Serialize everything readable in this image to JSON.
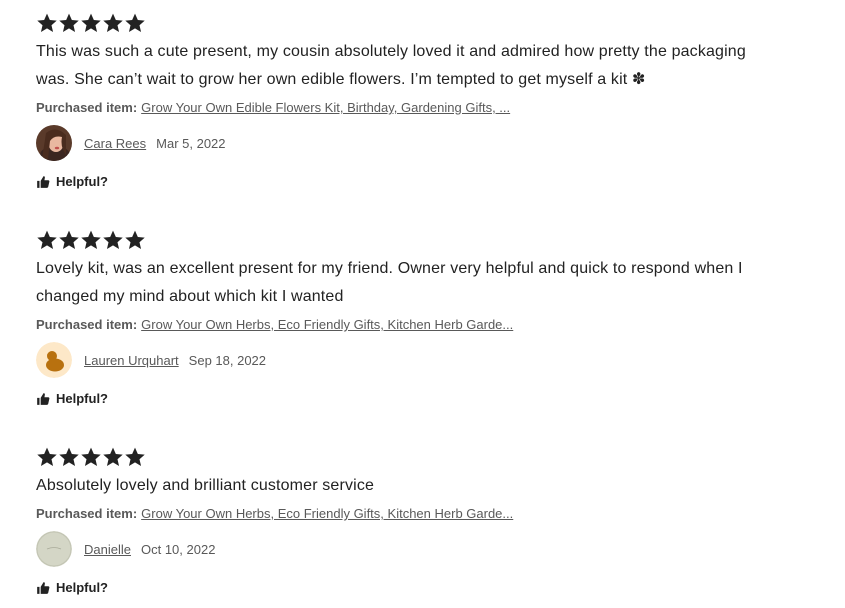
{
  "reviews": [
    {
      "rating": 5,
      "text_line1": "This was such a cute present, my cousin absolutely loved it and admired how pretty the packaging",
      "text_line2": "was. She can’t wait to grow her own edible flowers. I’m tempted to get myself a kit ✽",
      "purchased_label": "Purchased item:",
      "purchased_item": "Grow Your Own Edible Flowers Kit, Birthday, Gardening Gifts, ...",
      "author": "Cara Rees",
      "date": "Mar 5, 2022",
      "avatar": "photo-avatar",
      "helpful_label": "Helpful?"
    },
    {
      "rating": 5,
      "text_line1": "Lovely kit, was an excellent present for my friend. Owner very helpful and quick to respond when I",
      "text_line2": "changed my mind about which kit I wanted",
      "purchased_label": "Purchased item:",
      "purchased_item": "Grow Your Own Herbs, Eco Friendly Gifts, Kitchen Herb Garde...",
      "author": "Lauren Urquhart",
      "date": "Sep 18, 2022",
      "avatar": "default-avatar",
      "helpful_label": "Helpful?"
    },
    {
      "rating": 5,
      "text_line1": "Absolutely lovely and brilliant customer service",
      "text_line2": "",
      "purchased_label": "Purchased item:",
      "purchased_item": "Grow Your Own Herbs, Eco Friendly Gifts, Kitchen Herb Garde...",
      "author": "Danielle",
      "date": "Oct 10, 2022",
      "avatar": "photo-avatar",
      "helpful_label": "Helpful?"
    }
  ],
  "icons": {
    "star": "star-icon",
    "thumb": "thumbs-up-icon"
  },
  "colors": {
    "star": "#222222",
    "muted_text": "#595959",
    "default_avatar_bg": "#fde8c8",
    "default_avatar_fg": "#b8710f"
  }
}
